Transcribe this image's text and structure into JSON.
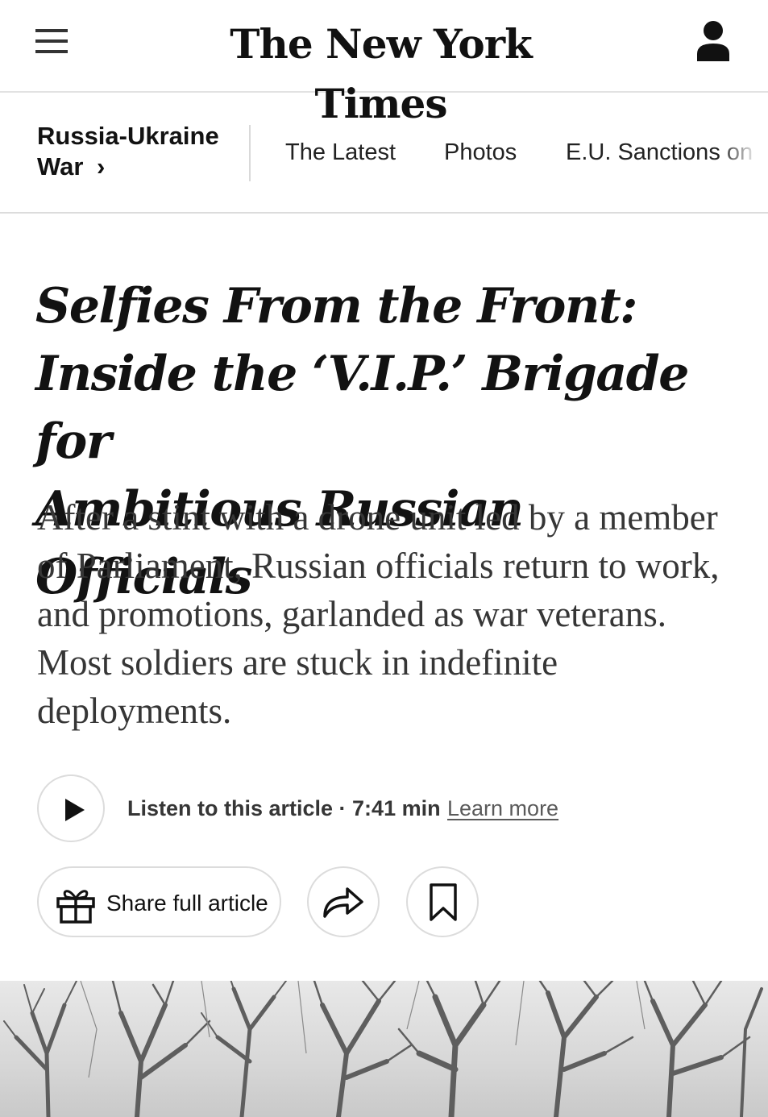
{
  "masthead": {
    "logo_text": "The New York Times",
    "menu_icon": "hamburger-menu-icon",
    "account_icon": "user-account-icon"
  },
  "section_nav": {
    "section_label_line1": "Russia-Ukraine",
    "section_label_line2": "War",
    "section_chevron": "›",
    "items": [
      {
        "label": "The Latest"
      },
      {
        "label": "Photos"
      },
      {
        "label": "E.U. Sanctions on F"
      }
    ]
  },
  "article": {
    "headline_lines": [
      "Selfies From the Front:",
      "Inside the ‘V.I.P.’ Brigade for",
      "Ambitious Russian Officials"
    ],
    "summary": "After a stint with a drone unit led by a member of Parliament, Russian officials return to work, and promotions, garlanded as war veterans. Most soldiers are stuck in indefinite deployments."
  },
  "audio": {
    "play_icon": "play-icon",
    "listen_label": "Listen to this article · 7:41 min",
    "learn_more": "Learn more"
  },
  "actions": {
    "share_label": "Share full article",
    "share_icon": "gift-icon",
    "forward_icon": "share-arrow-icon",
    "save_icon": "bookmark-icon"
  },
  "lead_image": {
    "subject": "bare-winter-trees-photo"
  },
  "colors": {
    "text": "#121212",
    "summary_text": "#363636",
    "border": "#dcdcdc"
  }
}
